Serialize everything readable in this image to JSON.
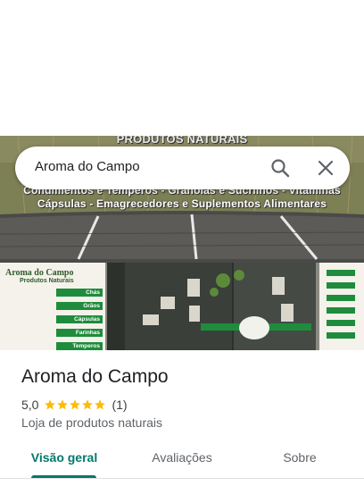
{
  "photo": {
    "sign_top": "PRODUTOS NATURAIS",
    "sign_line1": "Condimentos e Temperos - Granolas e Sucrilhos - Vitaminas",
    "sign_line2": "Cápsulas - Emagrecedores e Suplementos Alimentares",
    "panel_title": "Aroma do Campo",
    "panel_subtitle": "Produtos Naturais",
    "panel_tags": [
      "Chás",
      "Grãos",
      "Cápsulas",
      "Farinhas",
      "Temperos"
    ]
  },
  "search": {
    "query": "Aroma do Campo"
  },
  "place": {
    "name": "Aroma do Campo",
    "rating": "5,0",
    "stars": 5,
    "review_count": "(1)",
    "category": "Loja de produtos naturais"
  },
  "tabs": {
    "overview": "Visão geral",
    "reviews": "Avaliações",
    "about": "Sobre",
    "active": "overview"
  },
  "colors": {
    "accent": "#00796b",
    "star": "#fbbc04",
    "sign_green": "#1e8c3c"
  },
  "icons": {
    "search": "search-icon",
    "close": "close-icon",
    "star": "star-icon"
  }
}
